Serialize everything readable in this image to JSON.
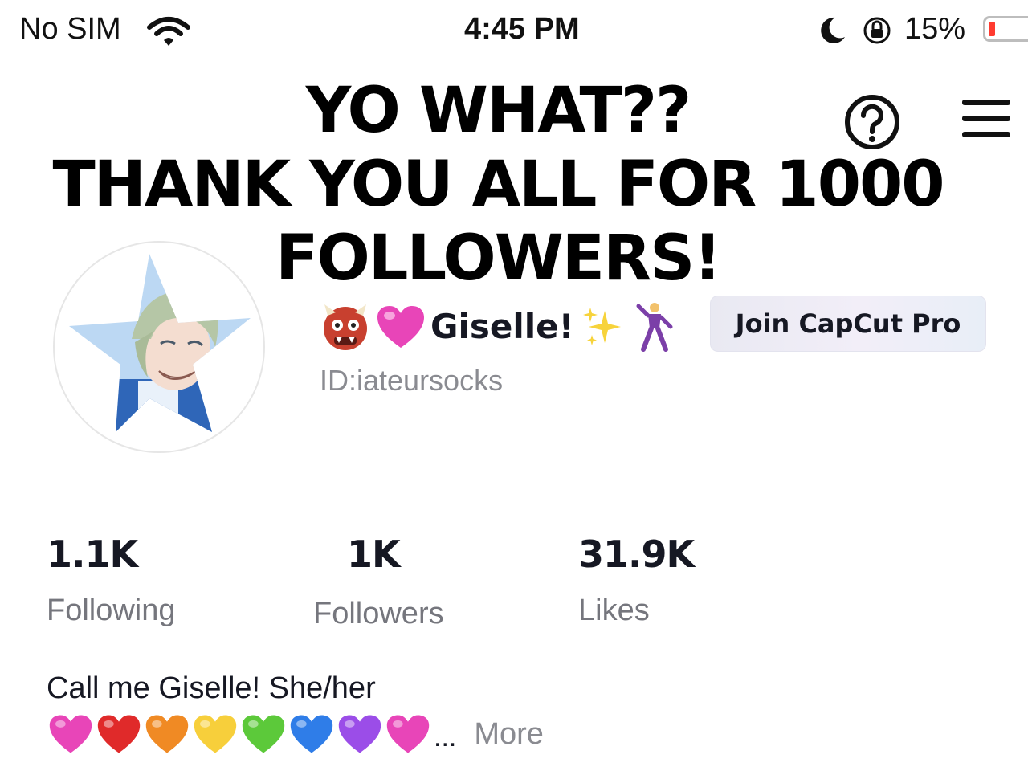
{
  "status_bar": {
    "carrier": "No SIM",
    "time": "4:45 PM",
    "battery_percent": "15%",
    "battery_level": 0.15,
    "battery_color": "#ff3b30",
    "icons": [
      "wifi-icon",
      "moon-icon",
      "orientation-lock-icon",
      "battery-icon"
    ]
  },
  "overlay_caption": {
    "line1": "YO WHAT??",
    "line2": "THANK YOU ALL FOR 1000",
    "line3": "FOLLOWERS!"
  },
  "header": {
    "icons": [
      "help-icon",
      "menu-icon"
    ]
  },
  "profile": {
    "avatar": "star-avatar",
    "name": "Giselle!",
    "name_emojis_before": [
      "ogre-emoji",
      "pink-heart-emoji"
    ],
    "name_emojis_after": [
      "sparkles-emoji",
      "dancer-emoji"
    ],
    "user_id": "ID:iateursocks",
    "pro_button_label": "Join CapCut Pro"
  },
  "stats": [
    {
      "value": "1.1K",
      "label": "Following"
    },
    {
      "value": "1K",
      "label": "Followers"
    },
    {
      "value": "31.9K",
      "label": "Likes"
    }
  ],
  "bio": {
    "line1": "Call me Giselle! She/her",
    "hearts": [
      "#e845b8",
      "#e02a2a",
      "#f08a24",
      "#f7cf3b",
      "#5cc93a",
      "#2f7de8",
      "#9b4de8",
      "#e845b8"
    ],
    "ellipsis": "...",
    "more_label": "More"
  }
}
